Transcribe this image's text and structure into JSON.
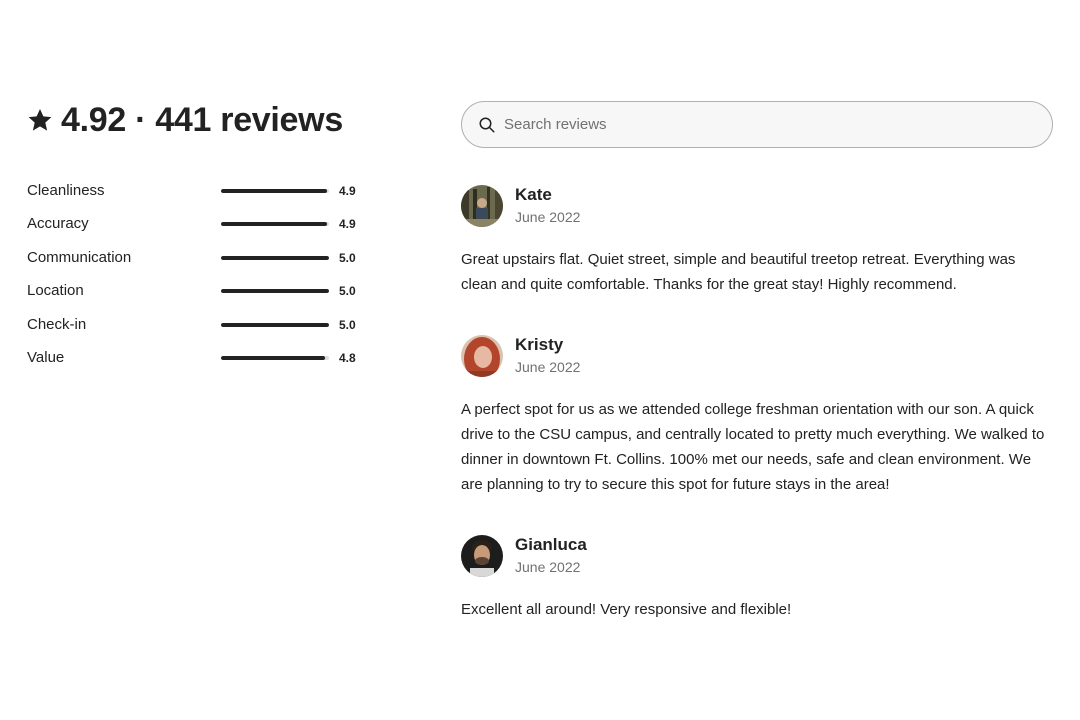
{
  "summary": {
    "title": "4.92 · 441 reviews",
    "icon": "star-icon"
  },
  "ratings": [
    {
      "label": "Cleanliness",
      "score": "4.9",
      "fraction": 0.98
    },
    {
      "label": "Accuracy",
      "score": "4.9",
      "fraction": 0.98
    },
    {
      "label": "Communication",
      "score": "5.0",
      "fraction": 1.0
    },
    {
      "label": "Location",
      "score": "5.0",
      "fraction": 1.0
    },
    {
      "label": "Check-in",
      "score": "5.0",
      "fraction": 1.0
    },
    {
      "label": "Value",
      "score": "4.8",
      "fraction": 0.96
    }
  ],
  "search": {
    "placeholder": "Search reviews",
    "icon": "search-icon"
  },
  "reviews": [
    {
      "name": "Kate",
      "date": "June 2022",
      "text": "Great upstairs flat. Quiet street, simple and beautiful treetop retreat. Everything was clean and quite comfortable. Thanks for the great stay! Highly recommend."
    },
    {
      "name": "Kristy",
      "date": "June 2022",
      "text": "A perfect spot for us as we attended college freshman orientation with our son. A quick drive to the CSU campus, and centrally located to pretty much everything. We walked to dinner in downtown Ft. Collins. 100% met our needs, safe and clean environment. We are planning to try to secure this spot for future stays in the area!"
    },
    {
      "name": "Gianluca",
      "date": "June 2022",
      "text": "Excellent all around! Very responsive and flexible!"
    }
  ],
  "colors": {
    "text": "#222222",
    "muted": "#717171",
    "bar_track": "#dddddd",
    "bar_fill": "#222222"
  }
}
